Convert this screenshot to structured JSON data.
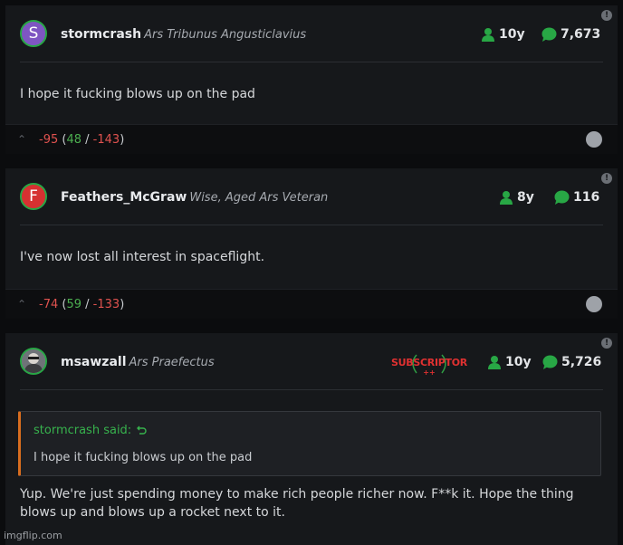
{
  "posts": [
    {
      "avatar_letter": "S",
      "avatar_color": "#7e56c2",
      "username": "stormcrash",
      "user_title": "Ars Tribunus Angusticlavius",
      "tenure": "10y",
      "comment_count": "7,673",
      "body": "I hope it fucking blows up on the pad",
      "score": "-95",
      "upvotes": "48",
      "downvotes": "-143"
    },
    {
      "avatar_letter": "F",
      "avatar_color": "#d63131",
      "username": "Feathers_McGraw",
      "user_title": "Wise, Aged Ars Veteran",
      "tenure": "8y",
      "comment_count": "116",
      "body": "I've now lost all interest in spaceflight.",
      "score": "-74",
      "upvotes": "59",
      "downvotes": "-133"
    },
    {
      "username": "msawzall",
      "user_title": "Ars Praefectus",
      "badge": "SUBSCRIPTOR",
      "badge_plus": "++",
      "tenure": "10y",
      "comment_count": "5,726",
      "quote_author": "stormcrash said:",
      "quote_text": "I hope it fucking blows up on the pad",
      "body": "Yup. We're just spending money to make rich people richer now. F**k it. Hope the thing blows up and blows up a rocket next to it."
    }
  ],
  "score_open": "(",
  "score_sep": "/",
  "score_close": ")",
  "corner_badge": "!",
  "watermark": "imgflip.com",
  "colors": {
    "accent_green": "#28a745",
    "negative": "#e0524f",
    "quote_border": "#d86d1f"
  }
}
